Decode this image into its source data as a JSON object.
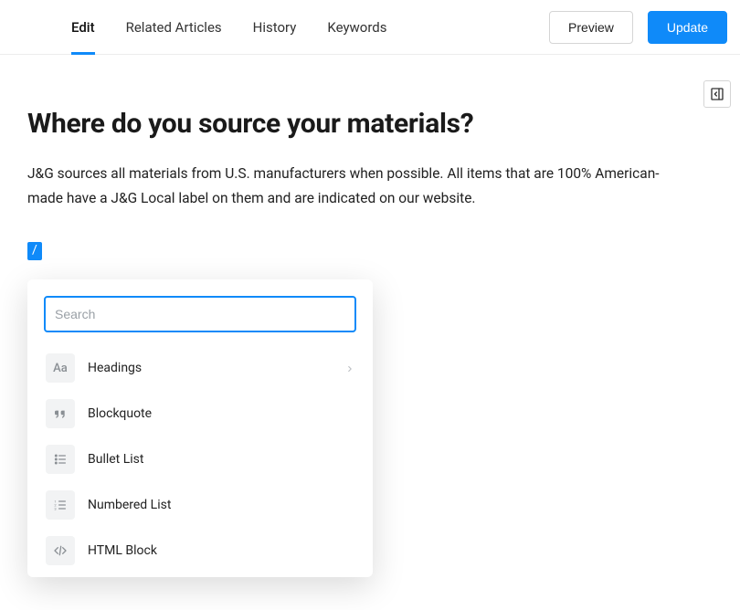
{
  "tabs": {
    "edit": "Edit",
    "related": "Related Articles",
    "history": "History",
    "keywords": "Keywords",
    "active": "edit"
  },
  "buttons": {
    "preview": "Preview",
    "update": "Update"
  },
  "article": {
    "title": "Where do you source your materials?",
    "body": "J&G sources all materials from U.S. manufacturers when possible. All items that are 100% American-made have a J&G Local label on them and are indicated on our website."
  },
  "slash": "/",
  "inserter": {
    "search_placeholder": "Search",
    "items": {
      "headings": "Headings",
      "blockquote": "Blockquote",
      "bullet_list": "Bullet List",
      "numbered_list": "Numbered List",
      "html_block": "HTML Block"
    }
  }
}
